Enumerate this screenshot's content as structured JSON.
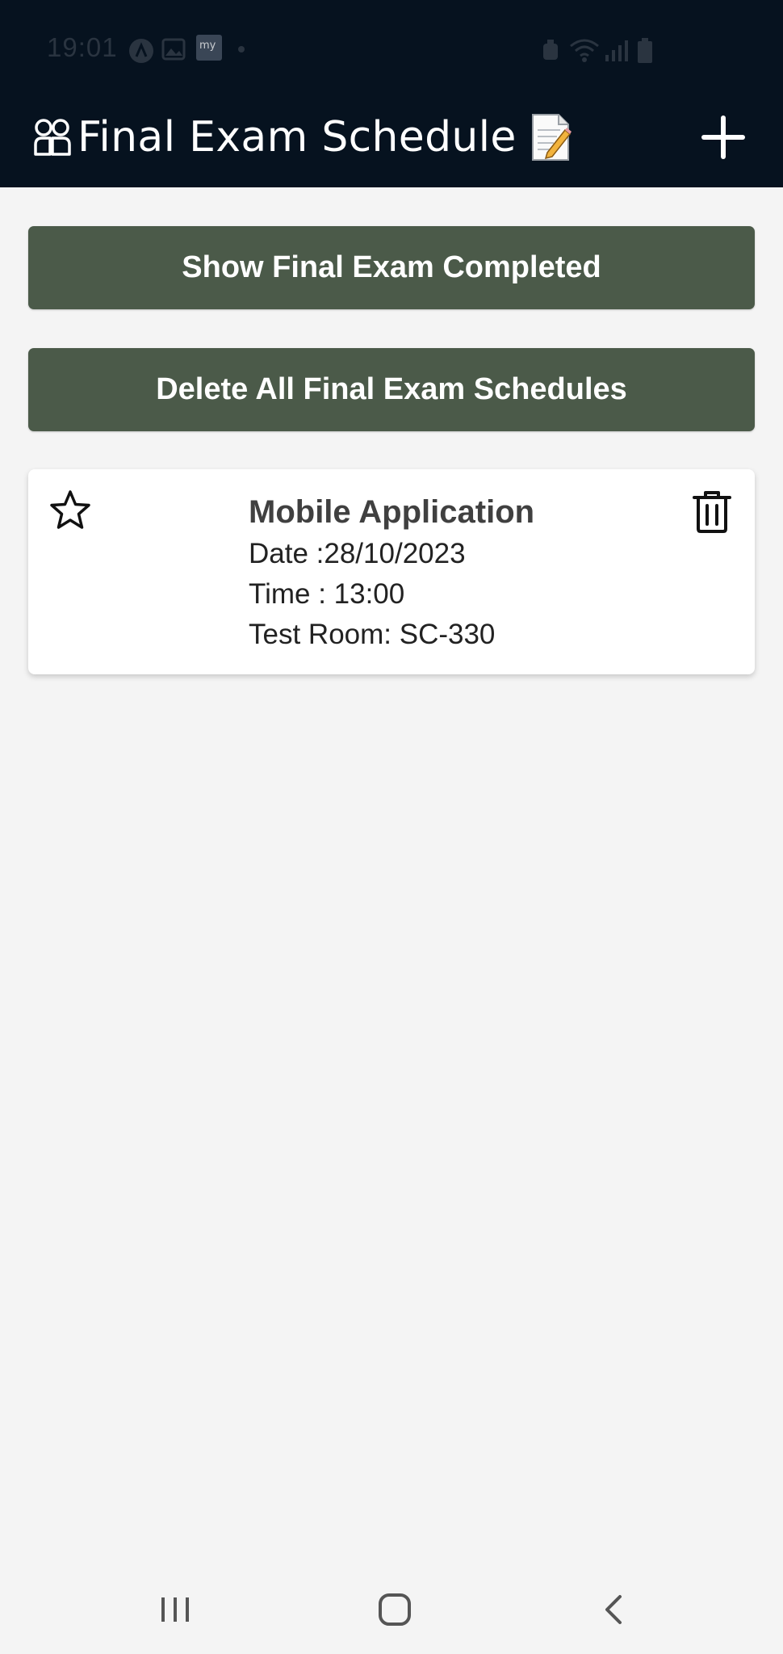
{
  "status_bar": {
    "time": "19:01",
    "icons": [
      "app-icon",
      "image-icon",
      "myais-app-icon",
      "dot-icon",
      "alarm-icon",
      "wifi-icon",
      "signal-icon",
      "battery-icon"
    ]
  },
  "toolbar": {
    "title": "Final Exam Schedule",
    "title_emoji": "📝",
    "add_icon": "plus-icon",
    "colors": {
      "background": "#06121f",
      "text": "#ffffff"
    }
  },
  "actions": {
    "show_completed_label": "Show Final Exam Completed",
    "delete_all_label": "Delete All Final Exam Schedules",
    "button_color": "#4b5a49"
  },
  "exams": [
    {
      "subject": "Mobile Application",
      "date_text": "Date :28/10/2023",
      "time_text": "Time : 13:00",
      "room_text": "Test Room: SC-330",
      "favorite": false
    }
  ],
  "nav_bar": {
    "icons": [
      "recent-apps-icon",
      "home-icon",
      "back-icon"
    ]
  }
}
